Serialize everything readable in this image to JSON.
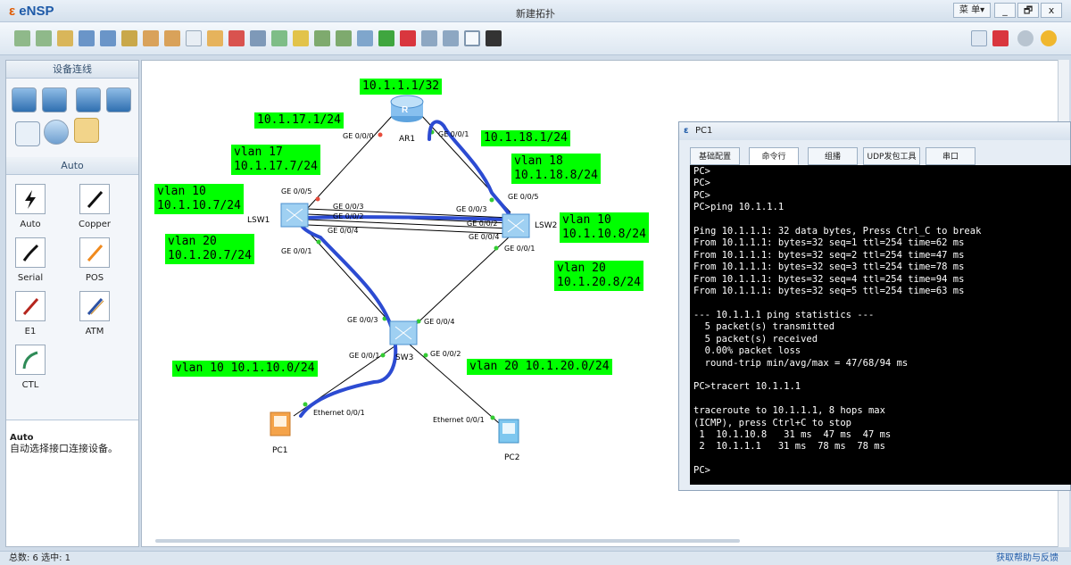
{
  "app": {
    "name": "eNSP",
    "title": "新建拓扑",
    "menu": "菜 单▾",
    "minimize": "_",
    "maximize": "🗗",
    "close": "x"
  },
  "left_panel": {
    "header": "设备连线",
    "auto_header": "Auto",
    "cables": [
      {
        "label": "Auto",
        "icon": "lightning-icon"
      },
      {
        "label": "Copper",
        "icon": "copper-cable-icon"
      },
      {
        "label": "Serial",
        "icon": "serial-cable-icon"
      },
      {
        "label": "POS",
        "icon": "pos-cable-icon"
      },
      {
        "label": "E1",
        "icon": "e1-cable-icon"
      },
      {
        "label": "ATM",
        "icon": "atm-cable-icon"
      },
      {
        "label": "CTL",
        "icon": "ctl-cable-icon"
      }
    ],
    "description_title": "Auto",
    "description": "自动选择接口连接设备。"
  },
  "devices": {
    "ar1": "AR1",
    "lsw1": "LSW1",
    "lsw2": "LSW2",
    "sw3": "SW3",
    "pc1": "PC1",
    "pc2": "PC2"
  },
  "ports": {
    "ar1_g000": "GE 0/0/0",
    "ar1_g001": "GE 0/0/1",
    "lsw1_g005": "GE 0/0/5",
    "lsw1_g003": "GE 0/0/3",
    "lsw1_g002": "GE 0/0/2",
    "lsw1_g004": "GE 0/0/4",
    "lsw1_g001": "GE 0/0/1",
    "lsw2_g005": "GE 0/0/5",
    "lsw2_g003": "GE 0/0/3",
    "lsw2_g002": "GE 0/0/2",
    "lsw2_g004": "GE 0/0/4",
    "lsw2_g001": "GE 0/0/1",
    "sw3_g003": "GE 0/0/3",
    "sw3_g004": "GE 0/0/4",
    "sw3_g001": "GE 0/0/1",
    "sw3_g002": "GE 0/0/2",
    "pc1_eth": "Ethernet 0/0/1",
    "pc2_eth": "Ethernet 0/0/1"
  },
  "labels": {
    "ar1_loop": "10.1.1.1/32",
    "ar1_g0": "10.1.17.1/24",
    "ar1_g1": "10.1.18.1/24",
    "lsw1_v17": "vlan 17\n10.1.17.7/24",
    "lsw1_v10": "vlan 10\n10.1.10.7/24",
    "lsw1_v20": "vlan 20\n10.1.20.7/24",
    "lsw2_v18": "vlan 18\n10.1.18.8/24",
    "lsw2_v10": "vlan 10\n10.1.10.8/24",
    "lsw2_v20": "vlan 20\n10.1.20.8/24",
    "net_v10": "vlan 10 10.1.10.0/24",
    "net_v20": "vlan 20 10.1.20.0/24"
  },
  "terminal": {
    "title": "PC1",
    "tabs": [
      "基础配置",
      "命令行",
      "组播",
      "UDP发包工具",
      "串口"
    ],
    "lines": [
      "PC>",
      "PC>",
      "PC>",
      "PC>ping 10.1.1.1",
      "",
      "Ping 10.1.1.1: 32 data bytes, Press Ctrl_C to break",
      "From 10.1.1.1: bytes=32 seq=1 ttl=254 time=62 ms",
      "From 10.1.1.1: bytes=32 seq=2 ttl=254 time=47 ms",
      "From 10.1.1.1: bytes=32 seq=3 ttl=254 time=78 ms",
      "From 10.1.1.1: bytes=32 seq=4 ttl=254 time=94 ms",
      "From 10.1.1.1: bytes=32 seq=5 ttl=254 time=63 ms",
      "",
      "--- 10.1.1.1 ping statistics ---",
      "  5 packet(s) transmitted",
      "  5 packet(s) received",
      "  0.00% packet loss",
      "  round-trip min/avg/max = 47/68/94 ms",
      "",
      "PC>tracert 10.1.1.1",
      "",
      "traceroute to 10.1.1.1, 8 hops max",
      "(ICMP), press Ctrl+C to stop",
      " 1  10.1.10.8   31 ms  47 ms  47 ms",
      " 2  10.1.1.1   31 ms  78 ms  78 ms",
      "",
      "PC>"
    ]
  },
  "status": {
    "left": "总数: 6 选中: 1",
    "right": "获取帮助与反馈"
  }
}
